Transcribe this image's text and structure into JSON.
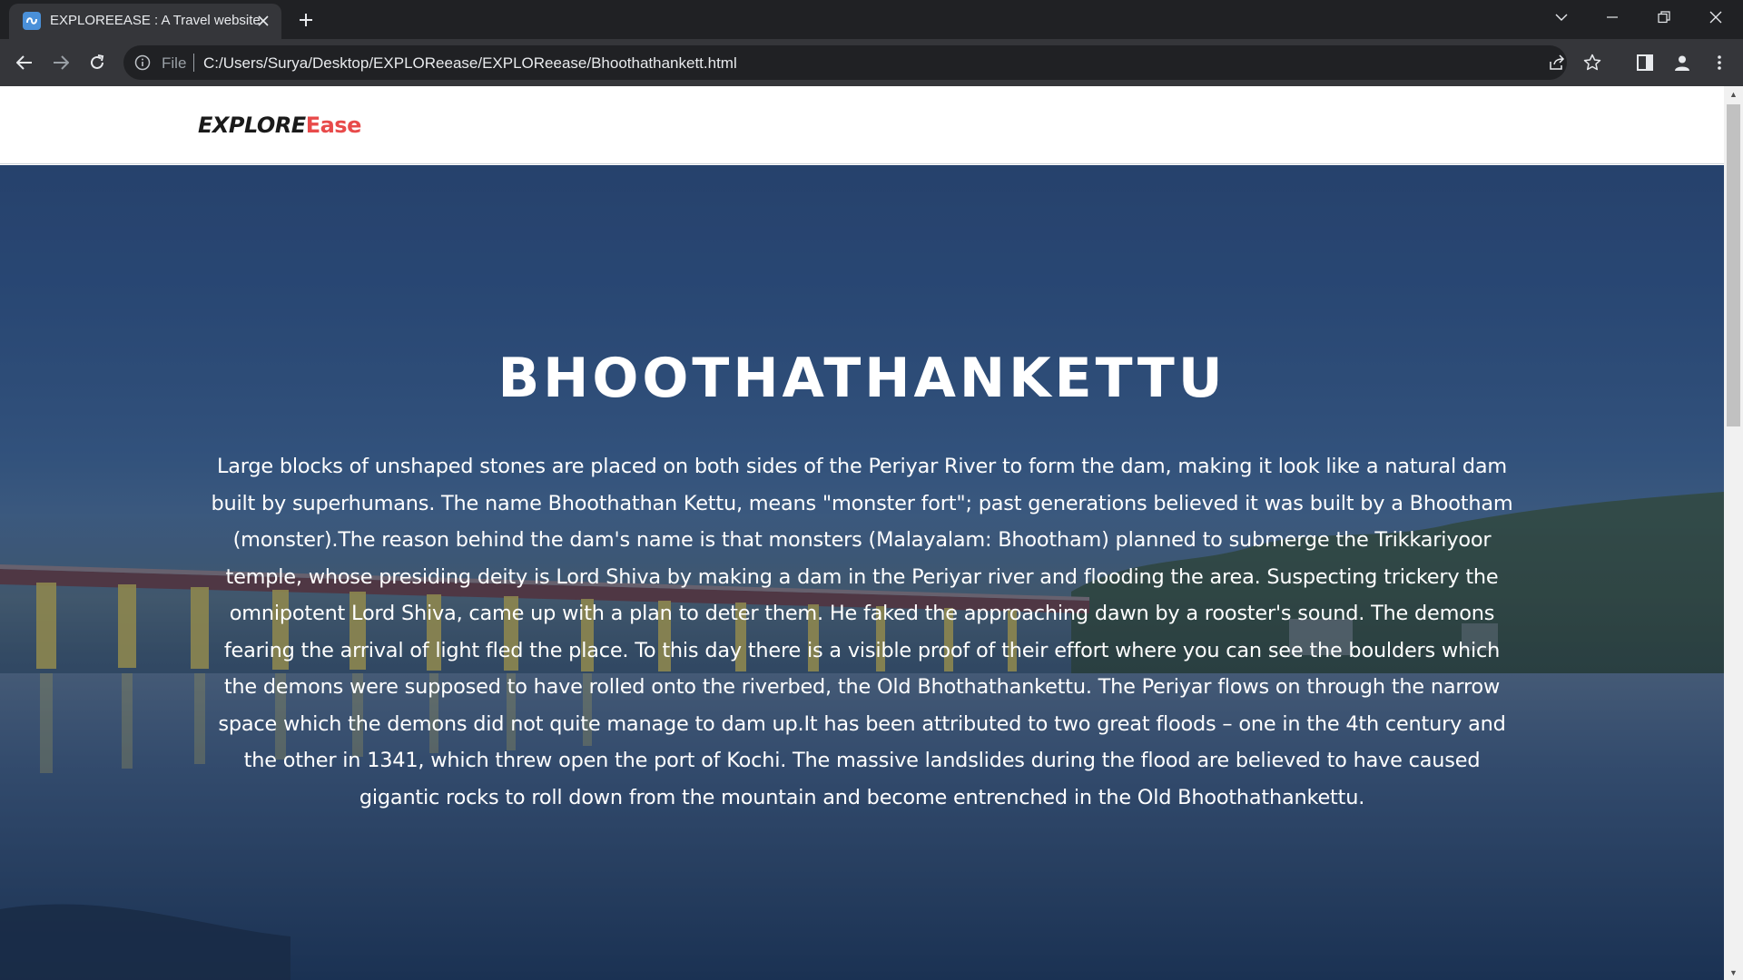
{
  "browser": {
    "tab_title": "EXPLOREEASE : A Travel website",
    "omnibox_scheme": "File",
    "url": "C:/Users/Surya/Desktop/EXPLOReease/EXPLOReease/Bhoothathankett.html"
  },
  "site": {
    "logo_part1": "EXPLORE",
    "logo_part2": "Ease",
    "logo_accent_color": "#e84a4a"
  },
  "hero": {
    "title": "BHOOTHATHANKETTU",
    "description": "Large blocks of unshaped stones are placed on both sides of the Periyar River to form the dam, making it look like a natural dam built by superhumans. The name Bhoothathan Kettu, means \"monster fort\"; past generations believed it was built by a Bhootham (monster).The reason behind the dam's name is that monsters (Malayalam: Bhootham) planned to submerge the Trikkariyoor temple, whose presiding deity is Lord Shiva by making a dam in the Periyar river and flooding the area. Suspecting trickery the omnipotent Lord Shiva, came up with a plan to deter them. He faked the approaching dawn by a rooster's sound. The demons fearing the arrival of light fled the place. To this day there is a visible proof of their effort where you can see the boulders which the demons were supposed to have rolled onto the riverbed, the Old Bhothathankettu. The Periyar flows on through the narrow space which the demons did not quite manage to dam up.It has been attributed to two great floods – one in the 4th century and the other in 1341, which threw open the port of Kochi. The massive landslides during the flood are believed to have caused gigantic rocks to roll down from the mountain and become entrenched in the Old Bhoothathankettu."
  },
  "icons": {
    "back": "arrow-left-icon",
    "forward": "arrow-right-icon",
    "reload": "reload-icon",
    "info": "info-icon",
    "share": "share-icon",
    "bookmark": "star-icon",
    "side_panel": "side-panel-icon",
    "profile": "profile-icon",
    "menu": "kebab-menu-icon"
  }
}
